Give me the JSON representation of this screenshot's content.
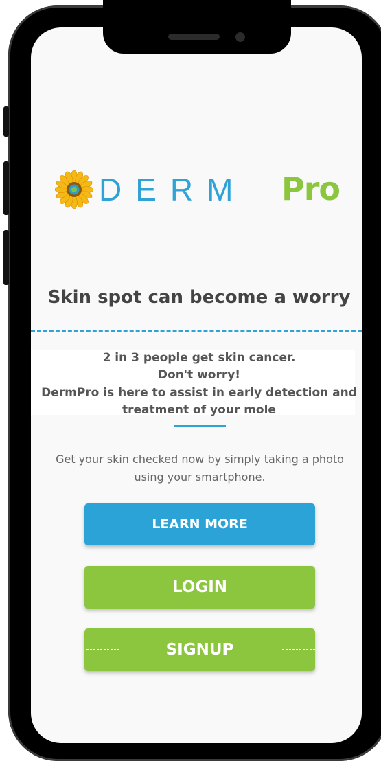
{
  "app": {
    "logo_text": "DERM",
    "logo_suffix": "Pro",
    "logo_colors": {
      "derm": "#2fa3d6",
      "pro": "#8cc63f",
      "sunflower": "#f2b41c"
    }
  },
  "hero": {
    "headline": "Skin spot can become a worry"
  },
  "info": {
    "line1": "2 in 3 people get skin cancer.",
    "line2": "Don't worry!",
    "line3": "DermPro is here to assist in early detection and",
    "line4": "treatment of your mole"
  },
  "subtext": "Get your skin checked now by simply taking a photo using your smartphone.",
  "buttons": {
    "learn_more": "LEARN MORE",
    "login": "LOGIN",
    "signup": "SIGNUP"
  },
  "colors": {
    "primary_blue": "#2ba3d6",
    "primary_green": "#8cc63f"
  }
}
